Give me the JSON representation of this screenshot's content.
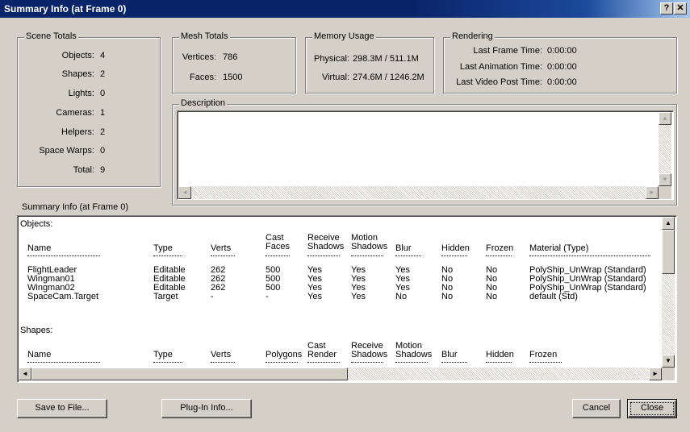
{
  "window": {
    "title": "Summary Info (at Frame 0)",
    "help_label": "?",
    "close_label": "✕"
  },
  "scene_totals": {
    "legend": "Scene Totals",
    "rows": [
      {
        "label": "Objects:",
        "value": "4"
      },
      {
        "label": "Shapes:",
        "value": "2"
      },
      {
        "label": "Lights:",
        "value": "0"
      },
      {
        "label": "Cameras:",
        "value": "1"
      },
      {
        "label": "Helpers:",
        "value": "2"
      },
      {
        "label": "Space Warps:",
        "value": "0"
      },
      {
        "label": "Total:",
        "value": "9"
      }
    ]
  },
  "mesh_totals": {
    "legend": "Mesh Totals",
    "vertices_label": "Vertices:",
    "vertices_value": "786",
    "faces_label": "Faces:",
    "faces_value": "1500"
  },
  "memory_usage": {
    "legend": "Memory Usage",
    "physical_label": "Physical:",
    "physical_value": "298.3M / 511.1M",
    "virtual_label": "Virtual:",
    "virtual_value": "274.6M / 1246.2M"
  },
  "rendering": {
    "legend": "Rendering",
    "rows": [
      {
        "label": "Last Frame Time:",
        "value": "0:00:00"
      },
      {
        "label": "Last Animation Time:",
        "value": "0:00:00"
      },
      {
        "label": "Last Video Post Time:",
        "value": "0:00:00"
      }
    ]
  },
  "description": {
    "legend": "Description",
    "value": ""
  },
  "summary_label": "Summary Info (at Frame 0)",
  "report": {
    "objects": {
      "heading": "Objects:",
      "headers": {
        "name": "Name",
        "type": "Type",
        "verts": "Verts",
        "cast_faces": [
          "Cast",
          "Faces"
        ],
        "receive_shadows": [
          "Receive",
          "Shadows"
        ],
        "motion_shadows": [
          "Motion",
          "Shadows"
        ],
        "blur": "Blur",
        "hidden": "Hidden",
        "frozen": "Frozen",
        "material": "Material (Type)"
      },
      "rows": [
        [
          "FlightLeader",
          "Editable",
          "262",
          "500",
          "Yes",
          "Yes",
          "Yes",
          "No",
          "No",
          "PolyShip_UnWrap (Standard)"
        ],
        [
          "Wingman01",
          "Editable",
          "262",
          "500",
          "Yes",
          "Yes",
          "Yes",
          "No",
          "No",
          "PolyShip_UnWrap (Standard)"
        ],
        [
          "Wingman02",
          "Editable",
          "262",
          "500",
          "Yes",
          "Yes",
          "Yes",
          "No",
          "No",
          "PolyShip_UnWrap (Standard)"
        ],
        [
          "SpaceCam.Target",
          "Target",
          "-",
          "-",
          "Yes",
          "Yes",
          "No",
          "No",
          "No",
          "default (Std)"
        ]
      ]
    },
    "shapes": {
      "heading": "Shapes:",
      "headers": {
        "name": "Name",
        "type": "Type",
        "verts": "Verts",
        "polygons": "Polygons",
        "cast_render": [
          "Cast",
          "Render"
        ],
        "receive_shadows": [
          "Receive",
          "Shadows"
        ],
        "motion_shadows": [
          "Motion",
          "Shadows"
        ],
        "blur": "Blur",
        "hidden": "Hidden",
        "frozen": "Frozen"
      }
    }
  },
  "buttons": {
    "save_to_file": "Save to File...",
    "plugin_info": "Plug-In Info...",
    "cancel": "Cancel",
    "close": "Close"
  },
  "scroll": {
    "up": "▲",
    "down": "▼",
    "left": "◄",
    "right": "►"
  }
}
